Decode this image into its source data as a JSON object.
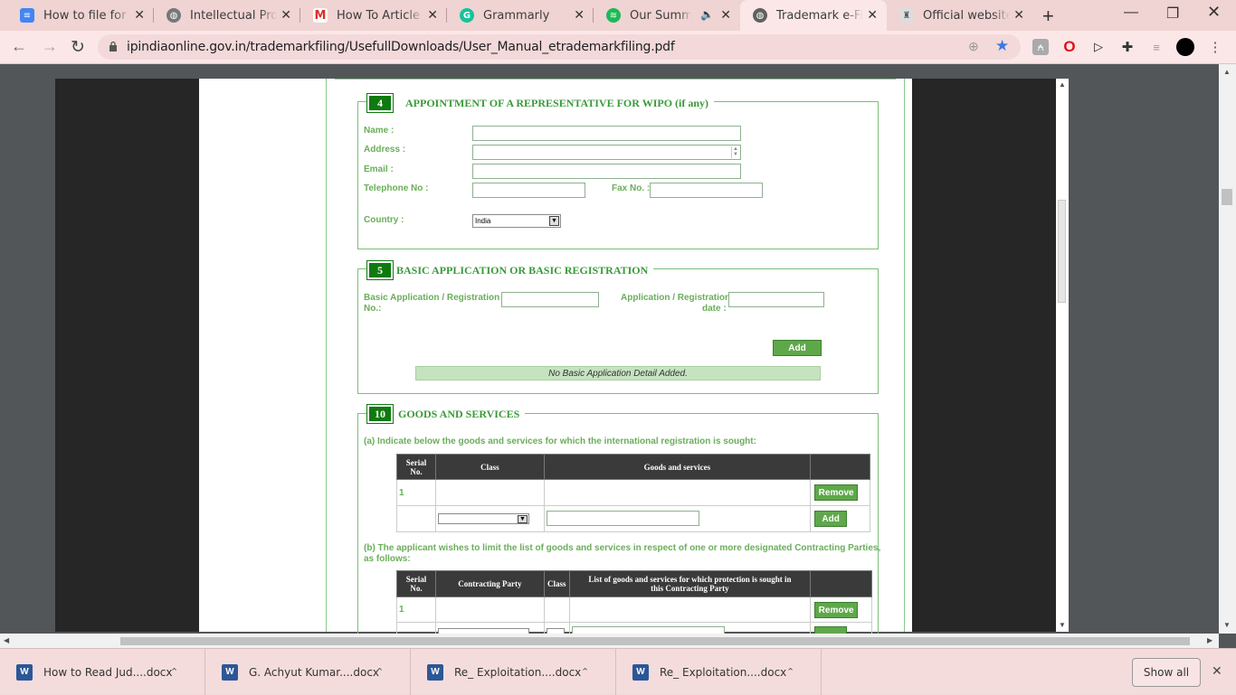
{
  "tabs": [
    {
      "title": "How to file for a Trademark",
      "icon": "docs-icon",
      "color": "#4285f4"
    },
    {
      "title": "Intellectual Property",
      "icon": "globe-icon",
      "color": "#606060"
    },
    {
      "title": "How To Article Submission",
      "icon": "gmail-icon",
      "color": "#d93025"
    },
    {
      "title": "Grammarly",
      "icon": "grammarly-icon",
      "color": "#15c39a"
    },
    {
      "title": "Our Summer",
      "icon": "spotify-icon",
      "color": "#1db954"
    },
    {
      "title": "Trademark e-Filing",
      "icon": "globe-icon",
      "color": "#606060"
    },
    {
      "title": "Official website of",
      "icon": "emblem-icon",
      "color": "#777777"
    }
  ],
  "address": {
    "url": "ipindiaonline.gov.in/trademarkfiling/UsefullDownloads/User_Manual_etrademarkfiling.pdf"
  },
  "section4": {
    "num": "4",
    "title": "APPOINTMENT OF A REPRESENTATIVE FOR WIPO (if any)",
    "name_label": "Name :",
    "address_label": "Address :",
    "email_label": "Email :",
    "telephone_label": "Telephone No :",
    "fax_label": "Fax No. :",
    "country_label": "Country :",
    "country_value": "India"
  },
  "section5": {
    "num": "5",
    "title": "BASIC APPLICATION OR BASIC REGISTRATION",
    "reg_no_label_1": "Basic Application / Registration",
    "reg_no_label_2": "No.:",
    "reg_date_label_1": "Application / Registration",
    "reg_date_label_2": "date :",
    "add_label": "Add",
    "nodata": "No Basic Application Detail Added."
  },
  "section10": {
    "num": "10",
    "title": "GOODS AND SERVICES",
    "sub_a": "(a) Indicate below the goods and services for which the international registration is sought:",
    "table_a": {
      "h_serial_1": "Serial",
      "h_serial_2": "No.",
      "h_class": "Class",
      "h_goods": "Goods and services",
      "row1_serial": "1",
      "remove_label": "Remove",
      "add_label": "Add"
    },
    "sub_b_1": "(b) The applicant wishes to limit the list of goods and services in respect of one or more designated Contracting Parties,",
    "sub_b_2": "as follows:",
    "table_b": {
      "h_serial_1": "Serial",
      "h_serial_2": "No.",
      "h_party": "Contracting Party",
      "h_class": "Class",
      "h_list_1": "List of goods and services for which protection is sought in",
      "h_list_2": "this Contracting Party",
      "row1_serial": "1",
      "remove_label": "Remove"
    }
  },
  "downloads": [
    {
      "name": "How to Read Jud....docx"
    },
    {
      "name": "G. Achyut Kumar....docx"
    },
    {
      "name": "Re_ Exploitation....docx"
    },
    {
      "name": "Re_ Exploitation....docx"
    }
  ],
  "shelf": {
    "show_all": "Show all"
  }
}
